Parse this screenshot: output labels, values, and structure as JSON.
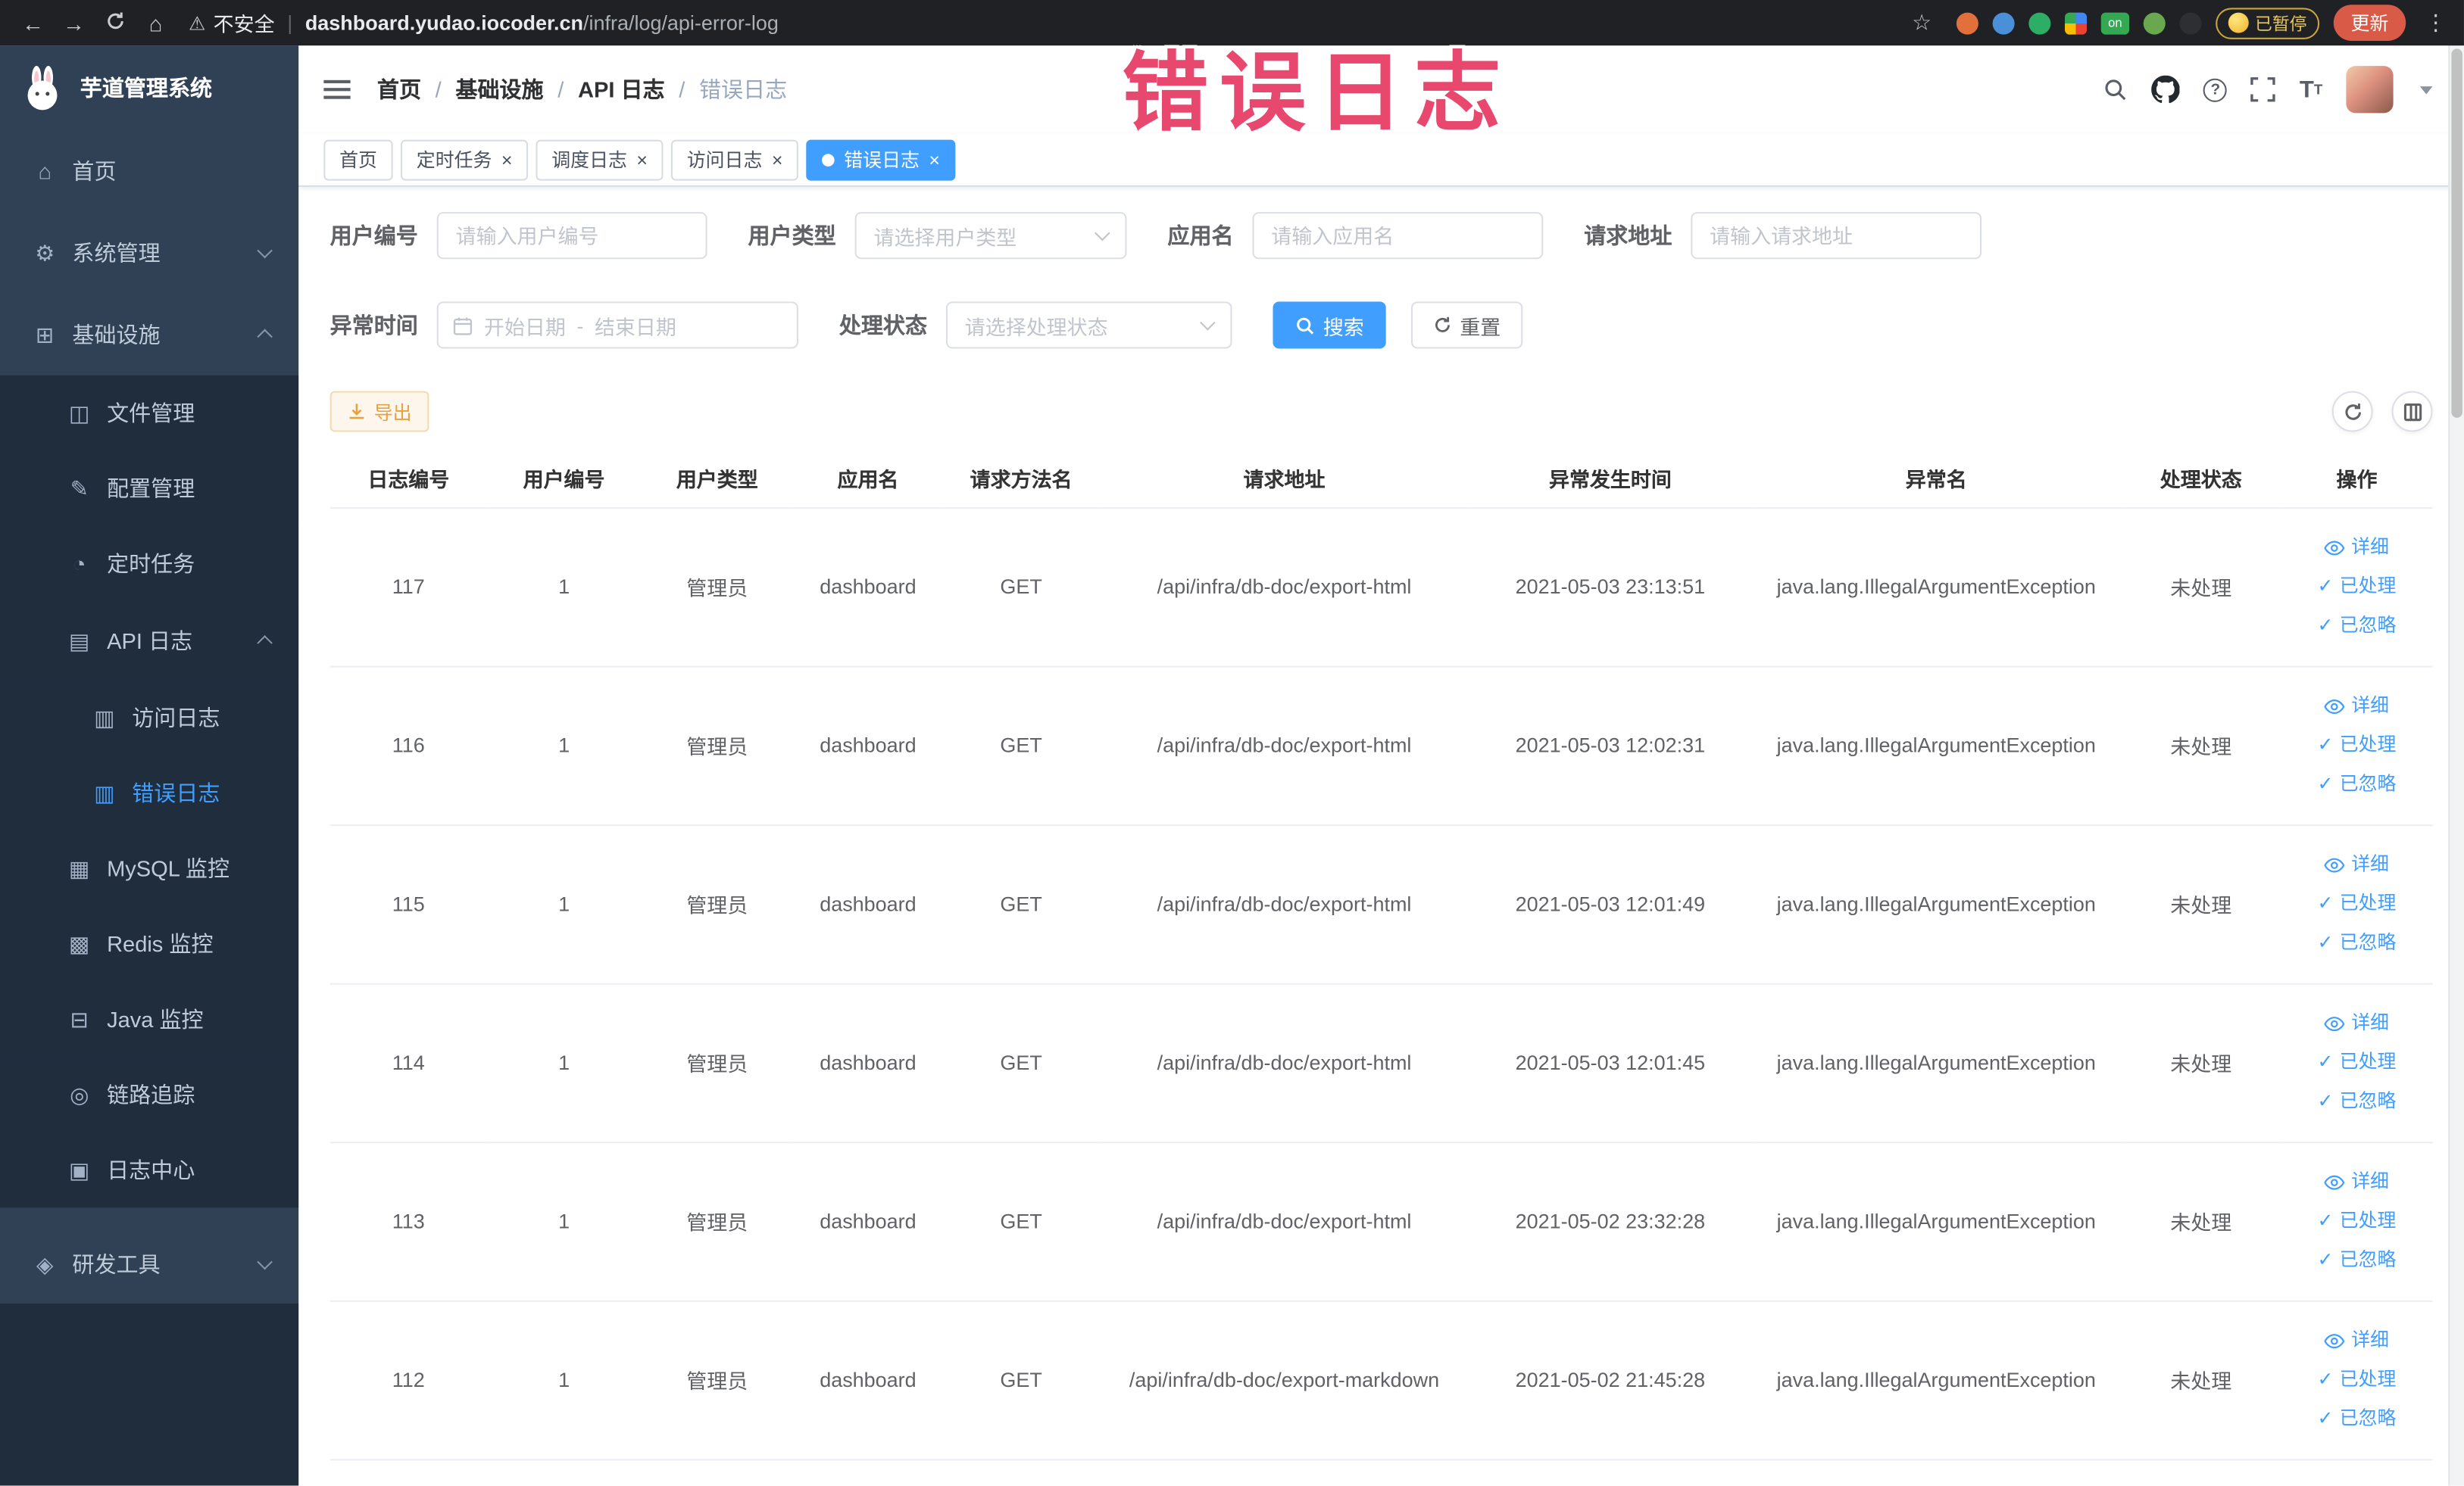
{
  "colors": {
    "accent": "#409EFF",
    "sidebar_bg": "#304156",
    "sidebar_submenu_bg": "#1f2d3d",
    "sidebar_text": "#bfcbd9",
    "annotation": "#e8486d",
    "warning_button_text": "#e6a23c",
    "chrome_bg": "#1f2125",
    "update_button_bg": "#d95b47",
    "active_tab_bg": "#409EFF"
  },
  "annotation": {
    "text": "错误日志"
  },
  "browser": {
    "icons": {
      "back": "←",
      "forward": "→",
      "home": "⌂",
      "star": "☆",
      "warning": "⚠",
      "overflow": "⋮",
      "divider": "|"
    },
    "security_label": "不安全",
    "url_domain": "dashboard.yudao.iocoder.cn",
    "url_path": "/infra/log/api-error-log",
    "extension_on_badge": "on",
    "paused_badge": "已暂停",
    "update_button": "更新"
  },
  "sidebar": {
    "logo_title": "芋道管理系统",
    "items": [
      {
        "label": "首页",
        "icon": "⌂"
      },
      {
        "label": "系统管理",
        "icon": "⚙"
      },
      {
        "label": "基础设施",
        "icon": "⊞"
      },
      {
        "label": "文件管理",
        "icon": "◫"
      },
      {
        "label": "配置管理",
        "icon": "✎"
      },
      {
        "label": "定时任务",
        "icon": "◔"
      },
      {
        "label": "API 日志",
        "icon": "▤"
      },
      {
        "label": "访问日志",
        "icon": "▥"
      },
      {
        "label": "错误日志",
        "icon": "▥"
      },
      {
        "label": "MySQL 监控",
        "icon": "▦"
      },
      {
        "label": "Redis 监控",
        "icon": "▩"
      },
      {
        "label": "Java 监控",
        "icon": "⊟"
      },
      {
        "label": "链路追踪",
        "icon": "◎"
      },
      {
        "label": "日志中心",
        "icon": "▣"
      },
      {
        "label": "研发工具",
        "icon": "◈"
      }
    ]
  },
  "header": {
    "breadcrumb": [
      "首页",
      "基础设施",
      "API 日志",
      "错误日志"
    ],
    "separator": "/",
    "icons": {
      "help": "?",
      "font_big": "T",
      "font_small": "T"
    }
  },
  "tabs": [
    {
      "label": "首页"
    },
    {
      "label": "定时任务"
    },
    {
      "label": "调度日志"
    },
    {
      "label": "访问日志"
    },
    {
      "label": "错误日志"
    }
  ],
  "ui": {
    "close_icon": "×",
    "check_icon": "✓",
    "date_separator": "-"
  },
  "filters": {
    "user_id": {
      "label": "用户编号",
      "placeholder": "请输入用户编号"
    },
    "user_type": {
      "label": "用户类型",
      "placeholder": "请选择用户类型"
    },
    "app_name": {
      "label": "应用名",
      "placeholder": "请输入应用名"
    },
    "request_url": {
      "label": "请求地址",
      "placeholder": "请输入请求地址"
    },
    "exception_time": {
      "label": "异常时间",
      "start_placeholder": "开始日期",
      "end_placeholder": "结束日期"
    },
    "process_status": {
      "label": "处理状态",
      "placeholder": "请选择处理状态"
    },
    "search_button": "搜索",
    "reset_button": "重置"
  },
  "toolbar": {
    "export_button": "导出"
  },
  "table": {
    "columns": [
      "日志编号",
      "用户编号",
      "用户类型",
      "应用名",
      "请求方法名",
      "请求地址",
      "异常发生时间",
      "异常名",
      "处理状态",
      "操作"
    ],
    "actions": {
      "detail": "详细",
      "processed": "已处理",
      "ignored": "已忽略"
    },
    "rows": [
      {
        "log_id": "117",
        "user_id": "1",
        "user_type": "管理员",
        "app_name": "dashboard",
        "method": "GET",
        "url": "/api/infra/db-doc/export-html",
        "time": "2021-05-03 23:13:51",
        "exception": "java.lang.IllegalArgumentException",
        "status": "未处理"
      },
      {
        "log_id": "116",
        "user_id": "1",
        "user_type": "管理员",
        "app_name": "dashboard",
        "method": "GET",
        "url": "/api/infra/db-doc/export-html",
        "time": "2021-05-03 12:02:31",
        "exception": "java.lang.IllegalArgumentException",
        "status": "未处理"
      },
      {
        "log_id": "115",
        "user_id": "1",
        "user_type": "管理员",
        "app_name": "dashboard",
        "method": "GET",
        "url": "/api/infra/db-doc/export-html",
        "time": "2021-05-03 12:01:49",
        "exception": "java.lang.IllegalArgumentException",
        "status": "未处理"
      },
      {
        "log_id": "114",
        "user_id": "1",
        "user_type": "管理员",
        "app_name": "dashboard",
        "method": "GET",
        "url": "/api/infra/db-doc/export-html",
        "time": "2021-05-03 12:01:45",
        "exception": "java.lang.IllegalArgumentException",
        "status": "未处理"
      },
      {
        "log_id": "113",
        "user_id": "1",
        "user_type": "管理员",
        "app_name": "dashboard",
        "method": "GET",
        "url": "/api/infra/db-doc/export-html",
        "time": "2021-05-02 23:32:28",
        "exception": "java.lang.IllegalArgumentException",
        "status": "未处理"
      },
      {
        "log_id": "112",
        "user_id": "1",
        "user_type": "管理员",
        "app_name": "dashboard",
        "method": "GET",
        "url": "/api/infra/db-doc/export-markdown",
        "time": "2021-05-02 21:45:28",
        "exception": "java.lang.IllegalArgumentException",
        "status": "未处理"
      }
    ]
  }
}
